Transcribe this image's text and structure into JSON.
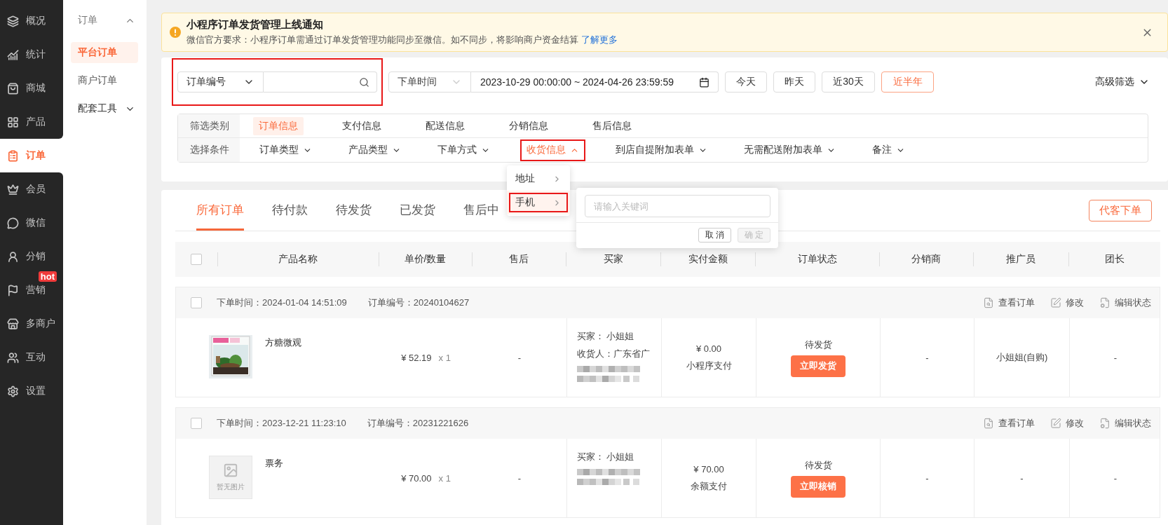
{
  "sidebar": {
    "items": [
      {
        "label": "概况",
        "selected": false
      },
      {
        "label": "统计",
        "selected": false
      },
      {
        "label": "商城",
        "selected": false
      },
      {
        "label": "产品",
        "selected": false
      },
      {
        "label": "订单",
        "selected": true
      },
      {
        "label": "会员",
        "selected": false
      },
      {
        "label": "微信",
        "selected": false
      },
      {
        "label": "分销",
        "selected": false
      },
      {
        "label": "营销",
        "selected": false,
        "badge": "hot"
      },
      {
        "label": "多商户",
        "selected": false
      },
      {
        "label": "互动",
        "selected": false
      },
      {
        "label": "设置",
        "selected": false
      }
    ]
  },
  "submenu": {
    "title": "订单",
    "expanded": true,
    "items": [
      {
        "label": "平台订单",
        "selected": true
      },
      {
        "label": "商户订单",
        "selected": false
      }
    ],
    "group": {
      "label": "配套工具",
      "expanded": false
    }
  },
  "notice": {
    "title": "小程序订单发货管理上线通知",
    "text": "微信官方要求：小程序订单需通过订单发货管理功能同步至微信。如不同步，将影响商户资金结算",
    "link": "了解更多"
  },
  "search": {
    "field": "订单编号",
    "highlighted": true
  },
  "date_filter": {
    "type": "下单时间",
    "start": "2023-10-29 00:00:00",
    "separator": "~",
    "end": "2024-04-26 23:59:59",
    "presets": [
      {
        "label": "今天",
        "selected": false
      },
      {
        "label": "昨天",
        "selected": false
      },
      {
        "label": "近30天",
        "selected": false
      },
      {
        "label": "近半年",
        "selected": true
      }
    ]
  },
  "advanced_filter": "高级筛选",
  "filter_table": {
    "category_label": "筛选类别",
    "categories": [
      {
        "label": "订单信息",
        "selected": true
      },
      {
        "label": "支付信息",
        "selected": false
      },
      {
        "label": "配送信息",
        "selected": false
      },
      {
        "label": "分销信息",
        "selected": false
      },
      {
        "label": "售后信息",
        "selected": false
      }
    ],
    "condition_label": "选择条件",
    "conditions": [
      {
        "label": "订单类型",
        "expanded": false,
        "highlighted": false
      },
      {
        "label": "产品类型",
        "expanded": false,
        "highlighted": false
      },
      {
        "label": "下单方式",
        "expanded": false,
        "highlighted": false
      },
      {
        "label": "收货信息",
        "expanded": true,
        "highlighted": true
      },
      {
        "label": "到店自提附加表单",
        "expanded": false,
        "highlighted": false
      },
      {
        "label": "无需配送附加表单",
        "expanded": false,
        "highlighted": false
      },
      {
        "label": "备注",
        "expanded": false,
        "highlighted": false
      }
    ]
  },
  "condition_menu": {
    "items": [
      {
        "label": "地址",
        "selected": false,
        "highlighted": false
      },
      {
        "label": "手机",
        "selected": true,
        "highlighted": true
      }
    ]
  },
  "keyword_popup": {
    "placeholder": "请输入关键词",
    "cancel": "取 消",
    "confirm": "确 定",
    "confirm_disabled": true
  },
  "tabs": [
    {
      "label": "所有订单",
      "selected": true
    },
    {
      "label": "待付款",
      "selected": false
    },
    {
      "label": "待发货",
      "selected": false
    },
    {
      "label": "已发货",
      "selected": false
    },
    {
      "label": "售后中",
      "selected": false
    }
  ],
  "new_order_button": "代客下单",
  "table": {
    "select_all_checked": false,
    "columns": [
      "产品名称",
      "单价/数量",
      "售后",
      "买家",
      "实付金额",
      "订单状态",
      "分销商",
      "推广员",
      "团长"
    ]
  },
  "orders": [
    {
      "checked": false,
      "time": "下单时间：2024-01-04 14:51:09",
      "number": "订单编号：20240104627",
      "actions": [
        "查看订单",
        "修改",
        "编辑状态"
      ],
      "product": {
        "name": "方糖微观"
      },
      "price": "¥ 52.19",
      "quantity": "x 1",
      "after_sale": "-",
      "buyer": "买家：  小姐姐",
      "consignee": "收货人：广东省广",
      "paid": "¥ 0.00",
      "payment": "小程序支付",
      "status": "待发货",
      "action": "立即发货",
      "distributor": "-",
      "promoter": "小姐姐(自购)",
      "leader": "-"
    },
    {
      "checked": false,
      "time": "下单时间：2023-12-21 11:23:10",
      "number": "订单编号：20231221626",
      "actions": [
        "查看订单",
        "修改",
        "编辑状态"
      ],
      "product": {
        "name": "票务",
        "image": {
          "kind": "placeholder",
          "text": "暂无图片"
        }
      },
      "price": "¥ 70.00",
      "quantity": "x 1",
      "after_sale": "-",
      "buyer": "买家：  小姐姐",
      "paid": "¥ 70.00",
      "payment": "余额支付",
      "status": "待发货",
      "action": "立即核销",
      "distributor": "-",
      "promoter": "-",
      "leader": "-"
    }
  ]
}
